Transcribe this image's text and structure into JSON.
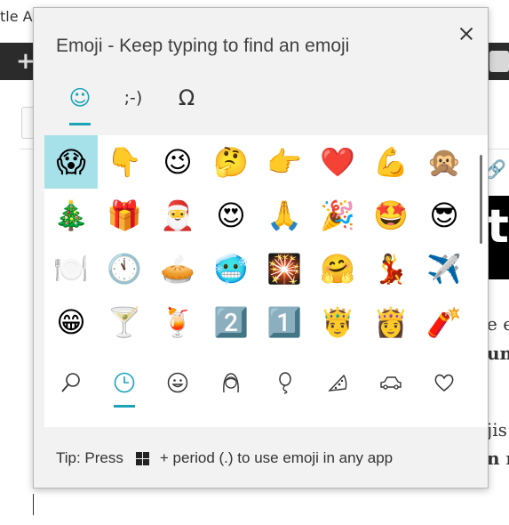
{
  "background": {
    "title_fragment": "tle A",
    "plus": "+",
    "link_glyph": "🔗",
    "image_letter": "t",
    "text_lines": [
      "e en",
      "un",
      "jis",
      "n m"
    ]
  },
  "panel": {
    "title": "Emoji - Keep typing to find an emoji",
    "close_icon": "✕",
    "top_tabs": [
      {
        "label": "☺",
        "name": "emoji"
      },
      {
        "label": ";-)",
        "name": "kaomoji"
      },
      {
        "label": "Ω",
        "name": "symbols"
      }
    ],
    "emojis": [
      "😱",
      "👇",
      "😉",
      "🤔",
      "👉",
      "❤️",
      "💪",
      "🙊",
      "🎄",
      "🎁",
      "🎅",
      "😍",
      "🙏",
      "🎉",
      "🤩",
      "😎",
      "🍽️",
      "🕚",
      "🥧",
      "🥶",
      "🎇",
      "🤗",
      "💃",
      "✈️",
      "😁",
      "🍸",
      "🍹",
      "2️⃣",
      "1️⃣",
      "🤴",
      "👸",
      "🧨"
    ],
    "categories": [
      {
        "icon": "⚲",
        "name": "search"
      },
      {
        "icon": "◷",
        "name": "recent"
      },
      {
        "icon": "☺",
        "name": "smileys"
      },
      {
        "icon": "☻",
        "name": "people"
      },
      {
        "icon": "⚲",
        "name": "celebration"
      },
      {
        "icon": "◭",
        "name": "food"
      },
      {
        "icon": "⛟",
        "name": "travel"
      },
      {
        "icon": "♡",
        "name": "symbols-heart"
      }
    ],
    "tip_before": "Tip: Press",
    "tip_after": "+ period (.) to use emoji in any app"
  }
}
